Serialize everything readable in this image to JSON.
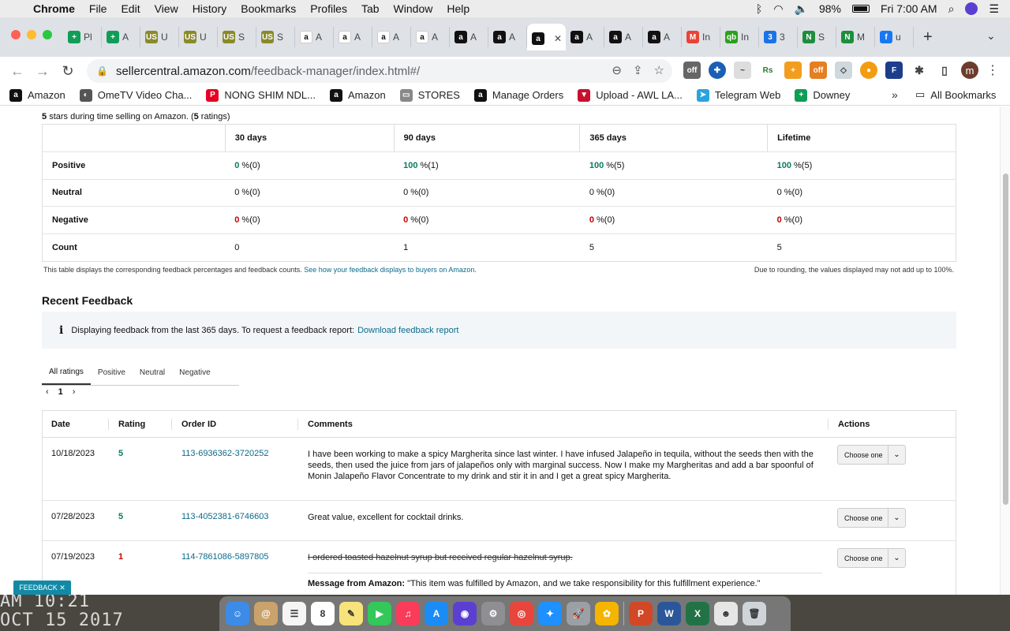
{
  "menubar": {
    "app": "Chrome",
    "items": [
      "File",
      "Edit",
      "View",
      "History",
      "Bookmarks",
      "Profiles",
      "Tab",
      "Window",
      "Help"
    ],
    "battery": "98%",
    "clock": "Fri 7:00 AM"
  },
  "tabs": [
    {
      "label": "Pl",
      "color": "#0f9d58",
      "glyph": "+"
    },
    {
      "label": "A",
      "color": "#0f9d58",
      "glyph": "+"
    },
    {
      "label": "U",
      "color": "#8a8a2a",
      "glyph": "US"
    },
    {
      "label": "U",
      "color": "#8a8a2a",
      "glyph": "US"
    },
    {
      "label": "S",
      "color": "#8a8a2a",
      "glyph": "US"
    },
    {
      "label": "S",
      "color": "#8a8a2a",
      "glyph": "US"
    },
    {
      "label": "A",
      "color": "#ffffff",
      "glyph": "a"
    },
    {
      "label": "A",
      "color": "#ffffff",
      "glyph": "a"
    },
    {
      "label": "A",
      "color": "#ffffff",
      "glyph": "a"
    },
    {
      "label": "A",
      "color": "#ffffff",
      "glyph": "a"
    },
    {
      "label": "A",
      "color": "#111111",
      "glyph": "a"
    },
    {
      "label": "A",
      "color": "#111111",
      "glyph": "a"
    },
    {
      "label": "",
      "color": "#111111",
      "glyph": "a",
      "active": true
    },
    {
      "label": "A",
      "color": "#111111",
      "glyph": "a"
    },
    {
      "label": "A",
      "color": "#111111",
      "glyph": "a"
    },
    {
      "label": "A",
      "color": "#111111",
      "glyph": "a"
    },
    {
      "label": "In",
      "color": "#ea4335",
      "glyph": "M"
    },
    {
      "label": "In",
      "color": "#2ca01c",
      "glyph": "qb"
    },
    {
      "label": "3",
      "color": "#1a73e8",
      "glyph": "3"
    },
    {
      "label": "S",
      "color": "#1e8e3e",
      "glyph": "N"
    },
    {
      "label": "M",
      "color": "#1e8e3e",
      "glyph": "N"
    },
    {
      "label": "u",
      "color": "#1877f2",
      "glyph": "f"
    }
  ],
  "address": {
    "host": "sellercentral.amazon.com",
    "path": "/feedback-manager/index.html#/"
  },
  "bookmarks": [
    {
      "label": "Amazon",
      "color": "#111111",
      "glyph": "a"
    },
    {
      "label": "OmeTV Video Cha...",
      "color": "#555555",
      "glyph": "◐"
    },
    {
      "label": "NONG SHIM NDL...",
      "color": "#e60023",
      "glyph": "P"
    },
    {
      "label": "Amazon",
      "color": "#111111",
      "glyph": "a"
    },
    {
      "label": "STORES",
      "color": "#888888",
      "glyph": "▭"
    },
    {
      "label": "Manage Orders",
      "color": "#111111",
      "glyph": "a"
    },
    {
      "label": "Upload - AWL LA...",
      "color": "#c8102e",
      "glyph": "▼"
    },
    {
      "label": "Telegram Web",
      "color": "#2aa3df",
      "glyph": "➤"
    },
    {
      "label": "Downey",
      "color": "#0f9d58",
      "glyph": "+"
    }
  ],
  "all_bookmarks": "All Bookmarks",
  "summary": {
    "stars_num": "5",
    "stars_text": "stars during time selling on Amazon. (",
    "ratings_num": "5",
    "ratings_text": "ratings)"
  },
  "feedback_table": {
    "headers": [
      "30 days",
      "90 days",
      "365 days",
      "Lifetime"
    ],
    "rows": [
      {
        "label": "Positive",
        "cells": [
          {
            "v": "0",
            "u": "%(0)"
          },
          {
            "v": "100",
            "u": "%(1)"
          },
          {
            "v": "100",
            "u": "%(5)"
          },
          {
            "v": "100",
            "u": "%(5)"
          }
        ],
        "kind": "pos"
      },
      {
        "label": "Neutral",
        "cells": [
          {
            "v": "0",
            "u": "%(0)"
          },
          {
            "v": "0",
            "u": "%(0)"
          },
          {
            "v": "0",
            "u": "%(0)"
          },
          {
            "v": "0",
            "u": "%(0)"
          }
        ],
        "kind": "neu"
      },
      {
        "label": "Negative",
        "cells": [
          {
            "v": "0",
            "u": "%(0)"
          },
          {
            "v": "0",
            "u": "%(0)"
          },
          {
            "v": "0",
            "u": "%(0)"
          },
          {
            "v": "0",
            "u": "%(0)"
          }
        ],
        "kind": "neg"
      },
      {
        "label": "Count",
        "cells": [
          {
            "v": "0",
            "u": ""
          },
          {
            "v": "1",
            "u": ""
          },
          {
            "v": "5",
            "u": ""
          },
          {
            "v": "5",
            "u": ""
          }
        ],
        "kind": "cnt"
      }
    ],
    "note": "This table displays the corresponding feedback percentages and feedback counts.",
    "note_link": "See how your feedback displays to buyers on Amazon.",
    "rounding_note": "Due to rounding, the values displayed may not add up to 100%."
  },
  "recent": {
    "title": "Recent Feedback",
    "info": "Displaying feedback from the last 365 days. To request a feedback report:",
    "info_link": "Download feedback report",
    "tabs": [
      "All ratings",
      "Positive",
      "Neutral",
      "Negative"
    ],
    "page": "1",
    "headers": {
      "date": "Date",
      "rating": "Rating",
      "order": "Order ID",
      "comments": "Comments",
      "actions": "Actions"
    },
    "rows": [
      {
        "date": "10/18/2023",
        "rating": "5",
        "order": "113-6936362-3720252",
        "comment": "I have been working to make a spicy Margherita since last winter. I have infused Jalapeño in tequila, without the seeds then with the seeds, then used the juice from jars of jalapeños only with marginal success. Now I make my Margheritas and add a bar spoonful of Monin Jalapeño Flavor Concentrate to my drink and stir it in and I get a great spicy Margherita.",
        "action": "Choose one"
      },
      {
        "date": "07/28/2023",
        "rating": "5",
        "order": "113-4052381-6746603",
        "comment": "Great value, excellent for cocktail drinks.",
        "action": "Choose one"
      },
      {
        "date": "07/19/2023",
        "rating": "1",
        "order": "114-7861086-5897805",
        "comment": "I ordered toasted hazelnut syrup but received regular hazelnut syrup.",
        "action": "Choose one",
        "msg_label": "Message from Amazon:",
        "msg": "\"This item was fulfilled by Amazon, and we take responsibility for this fulfillment experience.\""
      }
    ]
  },
  "feedback_badge": "FEEDBACK ✕",
  "wallpaper_clock": [
    "AM 10:21",
    "OCT 15 2017"
  ],
  "dock": [
    {
      "name": "finder",
      "color": "#3c8ce7",
      "glyph": "☺"
    },
    {
      "name": "contacts",
      "color": "#c9a36b",
      "glyph": "@"
    },
    {
      "name": "reminders",
      "color": "#f5f5f5",
      "glyph": "☰"
    },
    {
      "name": "calendar",
      "color": "#ffffff",
      "glyph": "8"
    },
    {
      "name": "notes",
      "color": "#f7e37a",
      "glyph": "✎"
    },
    {
      "name": "facetime",
      "color": "#34c759",
      "glyph": "▶"
    },
    {
      "name": "music",
      "color": "#fa3c5a",
      "glyph": "♫"
    },
    {
      "name": "appstore",
      "color": "#1b8cf5",
      "glyph": "A"
    },
    {
      "name": "siri",
      "color": "#5b3fd1",
      "glyph": "◉"
    },
    {
      "name": "settings",
      "color": "#8e8e93",
      "glyph": "⚙"
    },
    {
      "name": "chrome",
      "color": "#e8453c",
      "glyph": "◎"
    },
    {
      "name": "safari",
      "color": "#1e90ff",
      "glyph": "✦"
    },
    {
      "name": "launchpad",
      "color": "#9aa0a6",
      "glyph": "🚀"
    },
    {
      "name": "photos",
      "color": "#f4b400",
      "glyph": "✿"
    },
    {
      "name": "powerpoint",
      "color": "#d24726",
      "glyph": "P"
    },
    {
      "name": "word",
      "color": "#2b579a",
      "glyph": "W"
    },
    {
      "name": "excel",
      "color": "#217346",
      "glyph": "X"
    },
    {
      "name": "preview",
      "color": "#e6e6e6",
      "glyph": "☻"
    },
    {
      "name": "trash",
      "color": "#cfd4d9",
      "glyph": "🗑"
    }
  ]
}
